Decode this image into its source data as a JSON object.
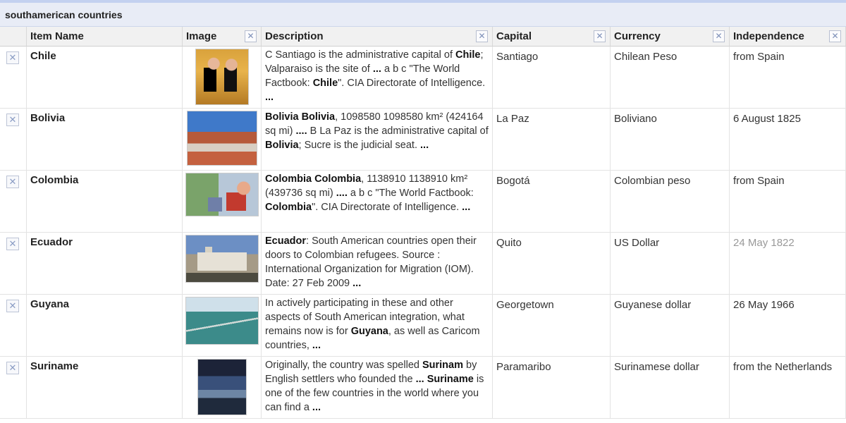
{
  "window": {
    "title": "southamerican countries"
  },
  "columns": [
    {
      "label": "",
      "removable": false
    },
    {
      "label": "Item Name",
      "removable": false
    },
    {
      "label": "Image",
      "removable": true
    },
    {
      "label": "Description",
      "removable": true
    },
    {
      "label": "Capital",
      "removable": true
    },
    {
      "label": "Currency",
      "removable": true
    },
    {
      "label": "Independence",
      "removable": true
    }
  ],
  "icons": {
    "remove": "close-icon",
    "remove_glyph": "✕"
  },
  "rows": [
    {
      "name": "Chile",
      "image": "chile-thumbnail",
      "description_html": "C Santiago is the administrative capital of <b>Chile</b>; Valparaiso is the site of <b>...</b> a b c \"The World Factbook: <b>Chile</b>\". CIA Directorate of Intelligence. <b>...</b>",
      "capital": "Santiago",
      "currency": "Chilean Peso",
      "independence": "from Spain"
    },
    {
      "name": "Bolivia",
      "image": "bolivia-thumbnail",
      "description_html": "<b>Bolivia Bolivia</b>, 1098580 1098580 km² (424164 sq mi) <b>....</b> B La Paz is the administrative capital of <b>Bolivia</b>; Sucre is the judicial seat. <b>...</b>",
      "capital": "La Paz",
      "currency": "Boliviano",
      "independence": "6 August 1825"
    },
    {
      "name": "Colombia",
      "image": "colombia-thumbnail",
      "description_html": "<b>Colombia Colombia</b>, 1138910 1138910 km² (439736 sq mi) <b>....</b> a b c \"The World Factbook: <b>Colombia</b>\". CIA Directorate of Intelligence. <b>...</b>",
      "capital": "Bogotá",
      "currency": "Colombian peso",
      "independence": "from Spain"
    },
    {
      "name": "Ecuador",
      "image": "ecuador-thumbnail",
      "description_html": "<b>Ecuador</b>: South American countries open their doors to Colombian refugees. Source : International Organization for Migration (IOM). Date: 27 Feb 2009 <b>...</b>",
      "capital": "Quito",
      "currency": "US Dollar",
      "independence": "24 May 1822",
      "independence_muted": true
    },
    {
      "name": "Guyana",
      "image": "guyana-thumbnail",
      "description_html": "In actively participating in these and other aspects of South American integration, what remains now is for <b>Guyana</b>, as well as Caricom countries, <b>...</b>",
      "capital": "Georgetown",
      "currency": "Guyanese dollar",
      "independence": "26 May 1966"
    },
    {
      "name": "Suriname",
      "image": "suriname-thumbnail",
      "description_html": "Originally, the country was spelled <b>Surinam</b> by English settlers who founded the <b>...</b> <b>Suriname</b> is one of the few countries in the world where you can find a <b>...</b>",
      "capital": "Paramaribo",
      "currency": "Surinamese dollar",
      "independence": "from the Netherlands"
    }
  ]
}
